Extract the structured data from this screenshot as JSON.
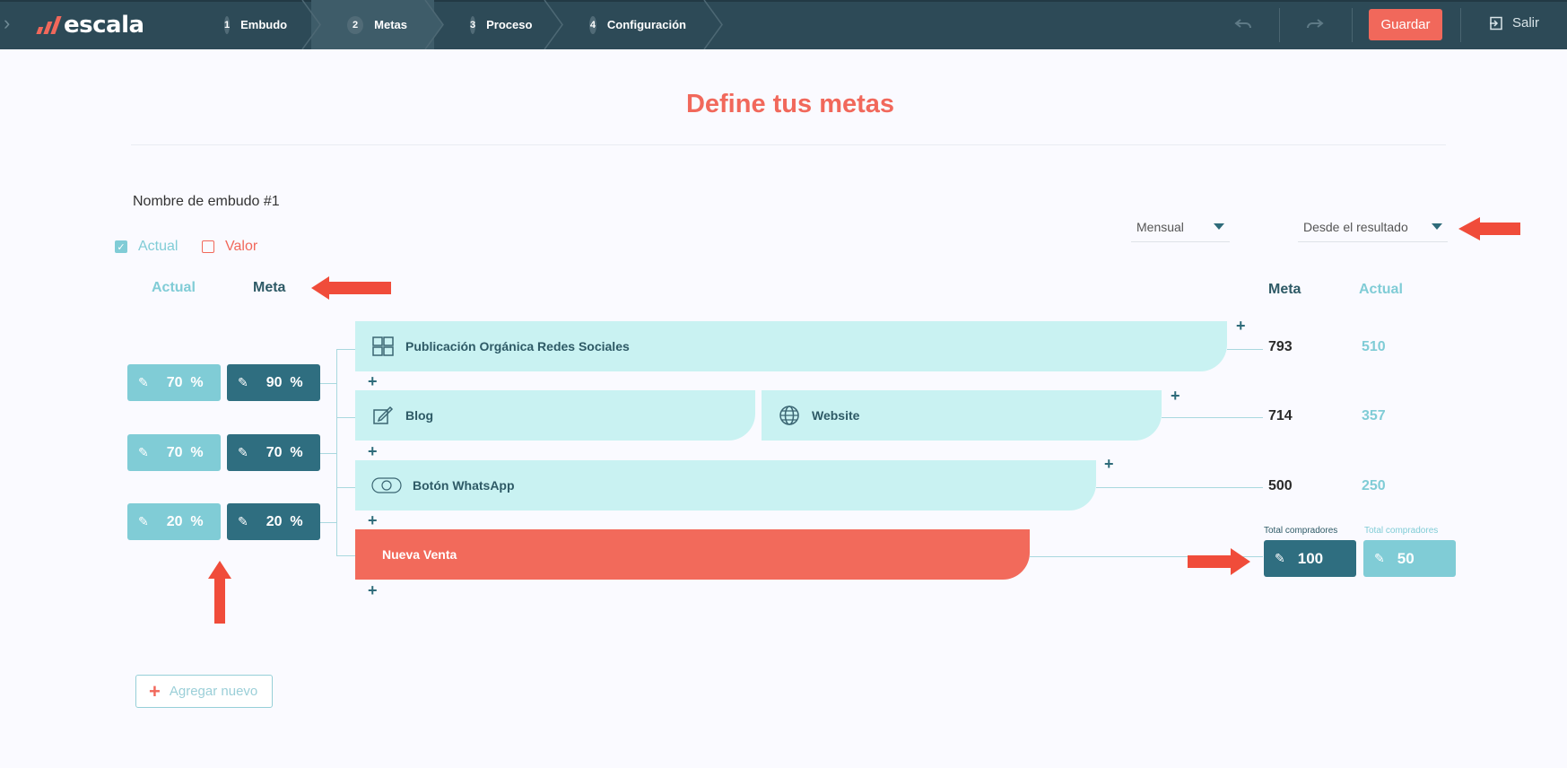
{
  "app": {
    "logo_text": "escala"
  },
  "steps": [
    {
      "num": "1",
      "label": "Embudo"
    },
    {
      "num": "2",
      "label": "Metas"
    },
    {
      "num": "3",
      "label": "Proceso"
    },
    {
      "num": "4",
      "label": "Configuración"
    }
  ],
  "toolbar": {
    "save_label": "Guardar",
    "exit_label": "Salir"
  },
  "page": {
    "title": "Define tus metas",
    "funnel_name": "Nombre de embudo #1"
  },
  "filters": {
    "actual_label": "Actual",
    "valor_label": "Valor",
    "actual_checked": true,
    "valor_checked": false
  },
  "columns": {
    "left_actual": "Actual",
    "left_meta": "Meta",
    "right_meta": "Meta",
    "right_actual": "Actual"
  },
  "selects": {
    "period": "Mensual",
    "mode": "Desde el resultado"
  },
  "rates": [
    {
      "actual": "70",
      "meta": "90",
      "unit": "%"
    },
    {
      "actual": "70",
      "meta": "70",
      "unit": "%"
    },
    {
      "actual": "20",
      "meta": "20",
      "unit": "%"
    }
  ],
  "stages": [
    {
      "label": "Publicación Orgánica Redes Sociales",
      "icon": "social-media-icon",
      "meta": "793",
      "actual": "510"
    },
    {
      "label": "Blog",
      "icon": "blog-edit-icon",
      "label2": "Website",
      "icon2": "globe-icon",
      "meta": "714",
      "actual": "357"
    },
    {
      "label": "Botón WhatsApp",
      "icon": "whatsapp-icon",
      "meta": "500",
      "actual": "250"
    },
    {
      "label": "Nueva Venta"
    }
  ],
  "totals": {
    "label": "Total compradores",
    "meta": "100",
    "actual": "50"
  },
  "add_new_label": "Agregar nuevo",
  "colors": {
    "brand": "#f1685b",
    "navy": "#2d4a57",
    "teal_light": "#80ccd6",
    "teal_dark": "#2f6e80",
    "stage_bg": "#c9f2f2",
    "arrow": "#f04c3a"
  }
}
